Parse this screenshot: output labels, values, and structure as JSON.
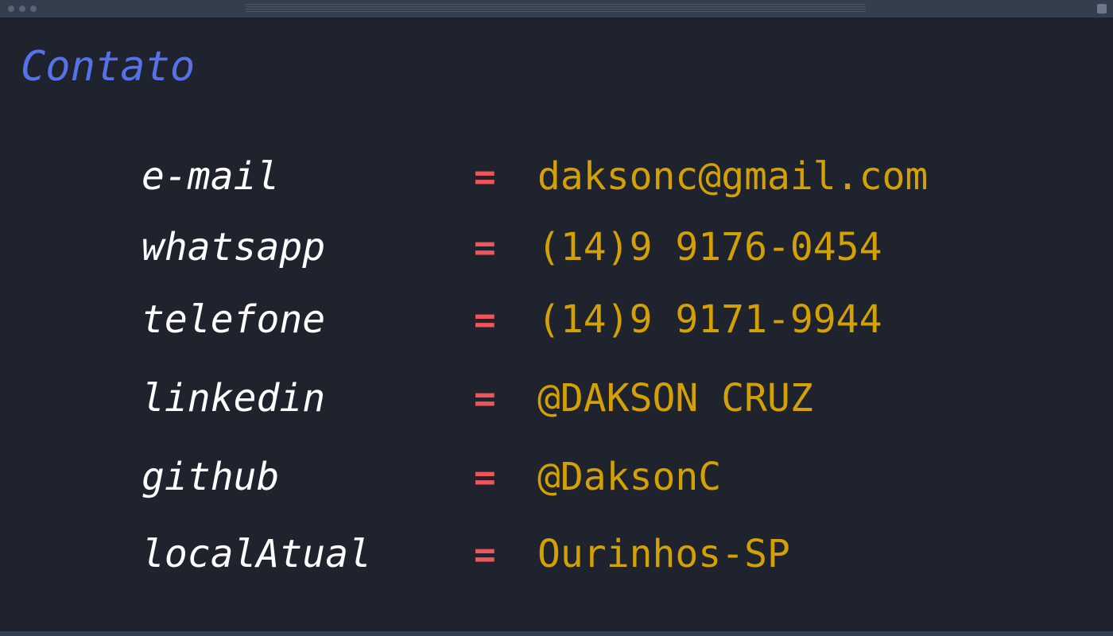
{
  "window": {
    "titlebar_icons": [
      "window-dot-icon",
      "window-dot-icon",
      "window-dot-icon",
      "drag-grip-icon",
      "window-button-icon"
    ]
  },
  "page": {
    "title": "Contato"
  },
  "contacts": [
    {
      "key": "e-mail",
      "operator": "=",
      "value": "daksonc@gmail.com"
    },
    {
      "key": "whatsapp",
      "operator": "=",
      "value": "(14)9 9176-0454"
    },
    {
      "key": "telefone",
      "operator": "=",
      "value": "(14)9 9171-9944"
    },
    {
      "key": "linkedin",
      "operator": "=",
      "value": "@DAKSON CRUZ"
    },
    {
      "key": "github",
      "operator": "=",
      "value": "@DaksonC"
    },
    {
      "key": "localAtual",
      "operator": "=",
      "value": "Ourinhos-SP"
    }
  ],
  "colors": {
    "background": "#1f232d",
    "titlebar": "#353e4d",
    "title": "#5572e8",
    "key": "#ffffff",
    "operator": "#f0555a",
    "value": "#d3a104"
  }
}
